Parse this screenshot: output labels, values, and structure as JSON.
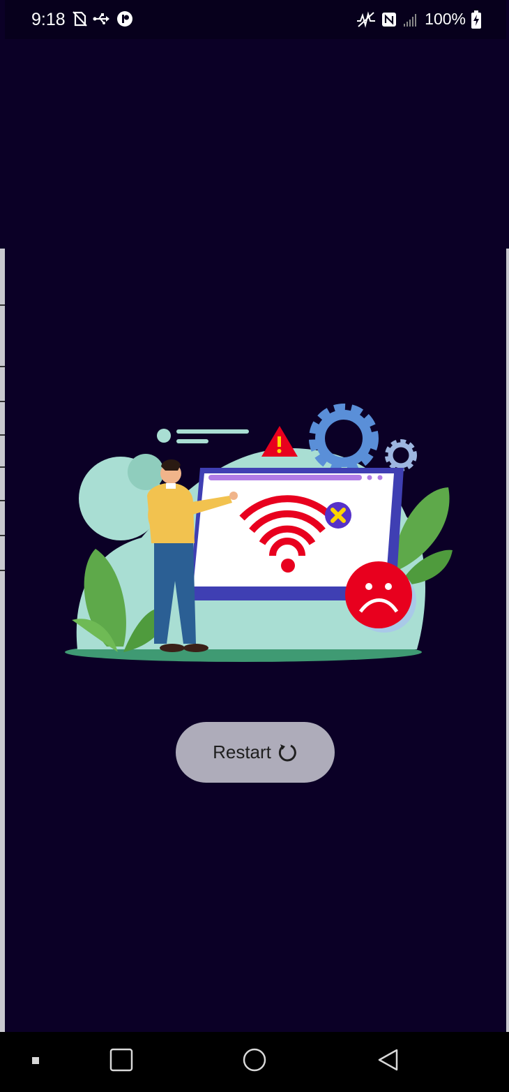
{
  "status_bar": {
    "time": "9:18",
    "battery_percent": "100%",
    "left_icons": [
      "no-sim-icon",
      "usb-icon",
      "app-notification-icon"
    ],
    "right_icons": [
      "vibrate-icon",
      "nfc-icon",
      "signal-icon",
      "battery-charging-icon"
    ]
  },
  "main": {
    "illustration": "no-internet-illustration",
    "restart_label": "Restart",
    "restart_icon": "refresh-icon"
  },
  "nav_bar": {
    "items": [
      "recents-dot-icon",
      "overview-square-icon",
      "home-circle-icon",
      "back-triangle-icon"
    ]
  },
  "colors": {
    "background": "#0b0026",
    "button": "#aeacba",
    "accent_red": "#e8001e",
    "screen_frame": "#3f3fb3"
  }
}
